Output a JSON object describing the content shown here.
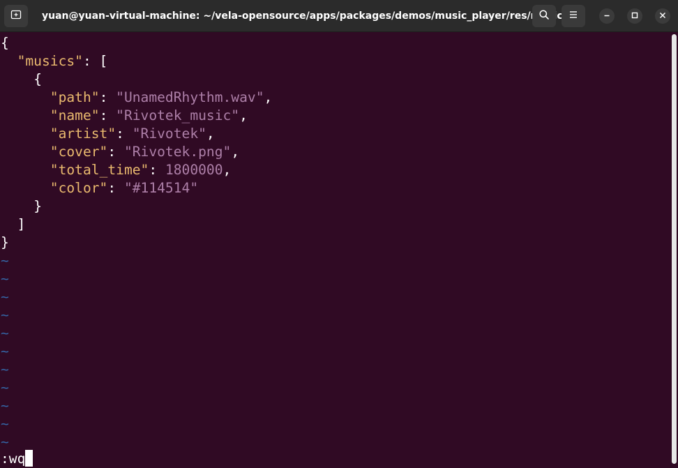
{
  "window": {
    "title": "yuan@yuan-virtual-machine: ~/vela-opensource/apps/packages/demos/music_player/res/musics"
  },
  "header_icons": {
    "new_tab": "new-tab-icon",
    "search": "search-icon",
    "menu": "hamburger-menu-icon",
    "minimize": "minimize-icon",
    "maximize": "maximize-icon",
    "close": "close-icon"
  },
  "editor": {
    "open_brace": "{",
    "musics_key": "\"musics\"",
    "colon_bracket": ": [",
    "inner_open": "{",
    "fields": [
      {
        "key": "\"path\"",
        "sep": ": ",
        "value": "\"UnamedRhythm.wav\"",
        "trail": ","
      },
      {
        "key": "\"name\"",
        "sep": ": ",
        "value": "\"Rivotek_music\"",
        "trail": ","
      },
      {
        "key": "\"artist\"",
        "sep": ": ",
        "value": "\"Rivotek\"",
        "trail": ","
      },
      {
        "key": "\"cover\"",
        "sep": ": ",
        "value": "\"Rivotek.png\"",
        "trail": ","
      },
      {
        "key": "\"total_time\"",
        "sep": ": ",
        "value": "1800000",
        "trail": ","
      },
      {
        "key": "\"color\"",
        "sep": ": ",
        "value": "\"#114514\"",
        "trail": ""
      }
    ],
    "inner_close": "}",
    "array_close": "]",
    "close_brace": "}",
    "empty_marker": "~",
    "command_line": ":wq"
  },
  "colors": {
    "background": "#300a24",
    "key": "#e9b96e",
    "string": "#ad7fa8",
    "tilde": "#3465a4",
    "titlebar": "#2b2b2b"
  }
}
